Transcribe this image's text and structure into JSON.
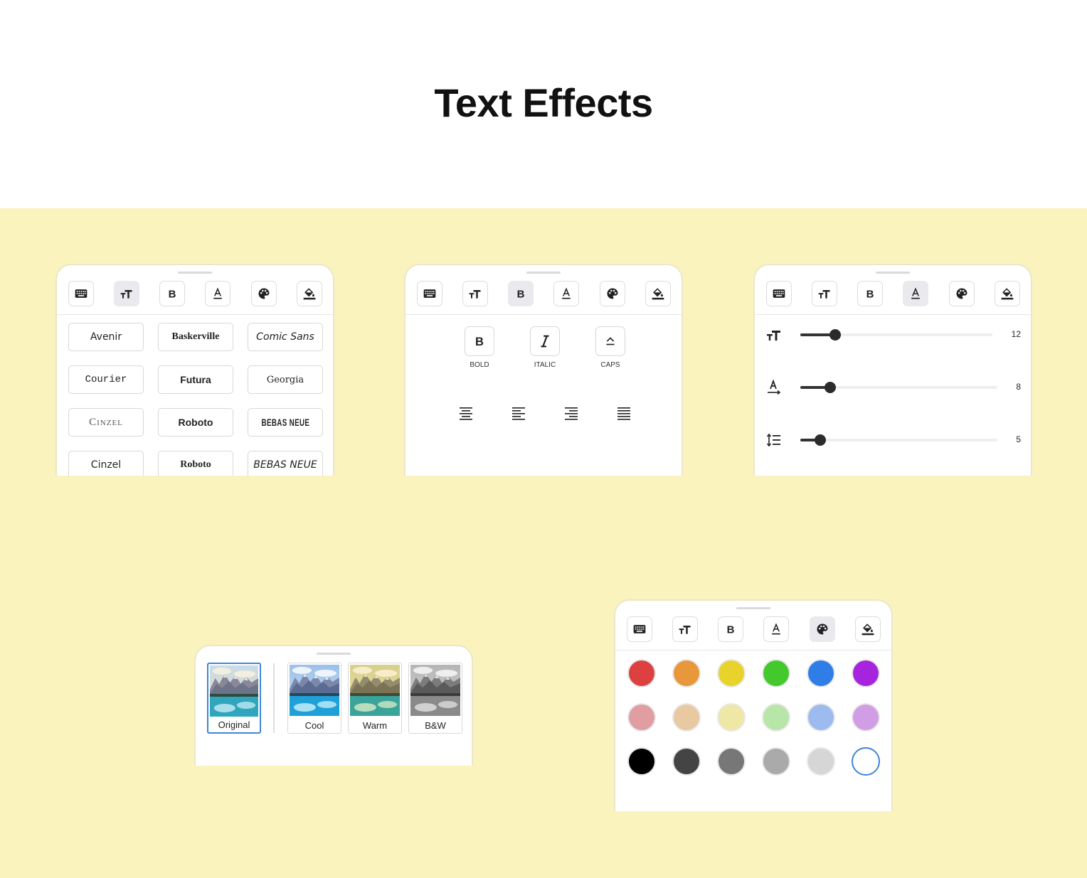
{
  "title": "Text Effects",
  "toolbar_icons": [
    "keyboard-icon",
    "text-size-icon",
    "bold-icon",
    "text-color-icon",
    "palette-icon",
    "fill-bucket-icon"
  ],
  "fonts_panel": {
    "active_tool": "text-size-icon",
    "fonts": [
      {
        "label": "Avenir"
      },
      {
        "label": "Baskerville"
      },
      {
        "label": "Comic Sans"
      },
      {
        "label": "Courier"
      },
      {
        "label": "Futura"
      },
      {
        "label": "Georgia"
      },
      {
        "label": "Cinzel"
      },
      {
        "label": "Roboto"
      },
      {
        "label": "BEBAS NEUE"
      },
      {
        "label": "Cinzel"
      },
      {
        "label": "Roboto"
      },
      {
        "label": "BEBAS NEUE"
      }
    ]
  },
  "style_panel": {
    "active_tool": "bold-icon",
    "styles": [
      {
        "label": "BOLD",
        "icon": "bold-icon"
      },
      {
        "label": "ITALIC",
        "icon": "italic-icon"
      },
      {
        "label": "CAPS",
        "icon": "caps-icon"
      }
    ],
    "alignments": [
      "align-center-icon",
      "align-left-icon",
      "align-right-icon",
      "align-justify-icon"
    ]
  },
  "slider_panel": {
    "active_tool": "text-color-icon",
    "sliders": [
      {
        "name": "font-size",
        "icon": "text-size-icon",
        "value": "12",
        "fraction": 0.18
      },
      {
        "name": "letter-spacing",
        "icon": "letter-spacing-icon",
        "value": "8",
        "fraction": 0.15
      },
      {
        "name": "line-height",
        "icon": "line-height-icon",
        "value": "5",
        "fraction": 0.1
      }
    ]
  },
  "filter_panel": {
    "filters": [
      {
        "label": "Original",
        "selected": true
      },
      {
        "label": "Cool",
        "selected": false
      },
      {
        "label": "Warm",
        "selected": false
      },
      {
        "label": "B&W",
        "selected": false
      }
    ]
  },
  "color_panel": {
    "active_tool": "palette-icon",
    "colors": [
      "#dd4040",
      "#e8973a",
      "#e8d32c",
      "#44c92d",
      "#2f7de6",
      "#a724de",
      "#e09ea0",
      "#e8c9a2",
      "#eee7a6",
      "#b8e6a8",
      "#9dbbef",
      "#d19ee6",
      "#000000",
      "#444444",
      "#777777",
      "#aaaaaa",
      "#d6d6d6",
      "outline"
    ]
  },
  "colors": {
    "background": "#fbf3bd",
    "selection": "#3d86d8"
  }
}
